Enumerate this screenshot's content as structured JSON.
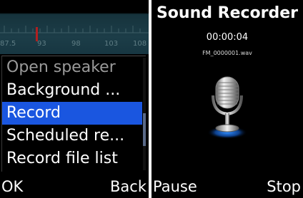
{
  "fm_radio": {
    "scale_labels": [
      "87.5",
      "93",
      "98",
      "103",
      "108"
    ],
    "menu_items": [
      {
        "label": "Open speaker",
        "state": "dim"
      },
      {
        "label": "Background ...",
        "state": "normal"
      },
      {
        "label": "Record",
        "state": "selected"
      },
      {
        "label": "Scheduled re...",
        "state": "normal"
      },
      {
        "label": "Record file list",
        "state": "normal"
      }
    ],
    "softkeys": {
      "left": "OK",
      "right": "Back"
    },
    "colors": {
      "selection": "#1a56e0",
      "needle": "#b02020"
    }
  },
  "sound_recorder": {
    "title": "Sound Recorder",
    "elapsed_time": "00:00:04",
    "file_name": "FM_0000001.wav",
    "icon": "microphone-icon",
    "softkeys": {
      "left": "Pause",
      "right": "Stop"
    }
  }
}
